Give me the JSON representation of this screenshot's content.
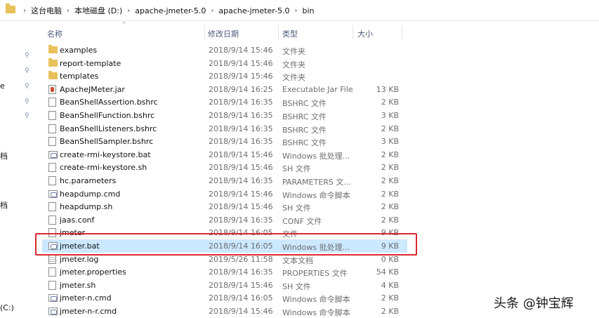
{
  "breadcrumb": {
    "items": [
      "这台电脑",
      "本地磁盘 (D:)",
      "apache-jmeter-5.0",
      "apache-jmeter-5.0",
      "bin"
    ]
  },
  "nav": {
    "fragments": [
      "e",
      "档",
      "档",
      "(C:)"
    ]
  },
  "columns": {
    "name": "名称",
    "date": "修改日期",
    "type": "类型",
    "size": "大小"
  },
  "files": [
    {
      "name": "examples",
      "date": "2018/9/14 15:46",
      "type": "文件夹",
      "size": "",
      "icon": "folder-icon"
    },
    {
      "name": "report-template",
      "date": "2018/9/14 15:46",
      "type": "文件夹",
      "size": "",
      "icon": "folder-icon"
    },
    {
      "name": "templates",
      "date": "2018/9/14 15:46",
      "type": "文件夹",
      "size": "",
      "icon": "folder-icon"
    },
    {
      "name": "ApacheJMeter.jar",
      "date": "2018/9/14 16:25",
      "type": "Executable Jar File",
      "size": "13 KB",
      "icon": "jar-icon"
    },
    {
      "name": "BeanShellAssertion.bshrc",
      "date": "2018/9/14 16:35",
      "type": "BSHRC 文件",
      "size": "2 KB",
      "icon": "file-icon"
    },
    {
      "name": "BeanShellFunction.bshrc",
      "date": "2018/9/14 16:35",
      "type": "BSHRC 文件",
      "size": "3 KB",
      "icon": "file-icon"
    },
    {
      "name": "BeanShellListeners.bshrc",
      "date": "2018/9/14 16:35",
      "type": "BSHRC 文件",
      "size": "2 KB",
      "icon": "file-icon"
    },
    {
      "name": "BeanShellSampler.bshrc",
      "date": "2018/9/14 16:35",
      "type": "BSHRC 文件",
      "size": "3 KB",
      "icon": "file-icon"
    },
    {
      "name": "create-rmi-keystore.bat",
      "date": "2018/9/14 15:46",
      "type": "Windows 批处理...",
      "size": "2 KB",
      "icon": "batch-file-icon"
    },
    {
      "name": "create-rmi-keystore.sh",
      "date": "2018/9/14 15:46",
      "type": "SH 文件",
      "size": "2 KB",
      "icon": "file-icon"
    },
    {
      "name": "hc.parameters",
      "date": "2018/9/14 16:35",
      "type": "PARAMETERS 文...",
      "size": "2 KB",
      "icon": "file-icon"
    },
    {
      "name": "heapdump.cmd",
      "date": "2018/9/14 15:46",
      "type": "Windows 命令脚本",
      "size": "2 KB",
      "icon": "batch-file-icon"
    },
    {
      "name": "heapdump.sh",
      "date": "2018/9/14 15:46",
      "type": "SH 文件",
      "size": "2 KB",
      "icon": "file-icon"
    },
    {
      "name": "jaas.conf",
      "date": "2018/9/14 16:35",
      "type": "CONF 文件",
      "size": "2 KB",
      "icon": "file-icon"
    },
    {
      "name": "jmeter",
      "date": "2018/9/14 16:05",
      "type": "文件",
      "size": "9 KB",
      "icon": "file-icon"
    },
    {
      "name": "jmeter.bat",
      "date": "2018/9/14 16:05",
      "type": "Windows 批处理...",
      "size": "9 KB",
      "icon": "batch-file-icon",
      "selected": true
    },
    {
      "name": "jmeter.log",
      "date": "2019/5/26 11:58",
      "type": "文本文档",
      "size": "0 KB",
      "icon": "text-document-icon"
    },
    {
      "name": "jmeter.properties",
      "date": "2018/9/14 16:35",
      "type": "PROPERTIES 文件",
      "size": "54 KB",
      "icon": "file-icon"
    },
    {
      "name": "jmeter.sh",
      "date": "2018/9/14 15:46",
      "type": "SH 文件",
      "size": "4 KB",
      "icon": "file-icon"
    },
    {
      "name": "jmeter-n.cmd",
      "date": "2018/9/14 16:05",
      "type": "Windows 命令脚本",
      "size": "2 KB",
      "icon": "batch-file-icon"
    },
    {
      "name": "jmeter-n-r.cmd",
      "date": "2018/9/14 15:46",
      "type": "Windows 命令脚本",
      "size": "2 KB",
      "icon": "batch-file-icon"
    }
  ],
  "colors": {
    "selection": "#cce8ff",
    "highlight_border": "#d9282f",
    "folder": "#e8c15a",
    "header_text": "#4d5b7a"
  },
  "watermark": "头条 @钟宝辉"
}
